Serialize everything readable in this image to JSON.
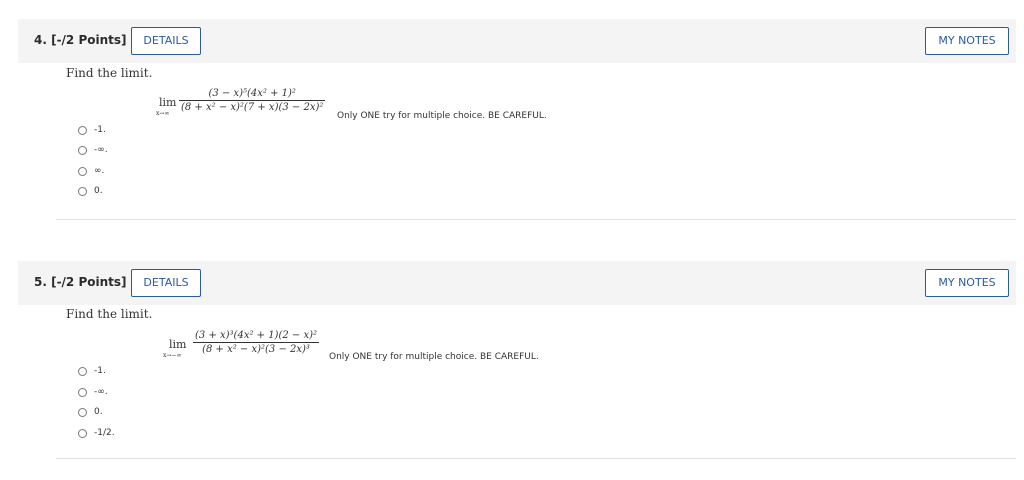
{
  "questions": [
    {
      "number_label": "4. [-/2 Points]",
      "details_label": "DETAILS",
      "notes_label": "MY NOTES",
      "prompt": "Find the limit.",
      "lim_label": "lim",
      "lim_sub": "x→∞",
      "numerator": "(3 − x)⁵(4x² + 1)²",
      "denominator": "(8 + x² − x)²(7 + x)(3 − 2x)²",
      "note": "Only ONE try for multiple choice. BE CAREFUL.",
      "choices": [
        "-1.",
        "-∞.",
        "∞.",
        "0."
      ]
    },
    {
      "number_label": "5. [-/2 Points]",
      "details_label": "DETAILS",
      "notes_label": "MY NOTES",
      "prompt": "Find the limit.",
      "lim_label": "lim",
      "lim_sub": "x→−∞",
      "numerator": "(3 + x)³(4x² + 1)(2 − x)²",
      "denominator": "(8 + x² − x)²(3 − 2x)³",
      "note": "Only ONE try for multiple choice. BE CAREFUL.",
      "choices": [
        "-1.",
        "-∞.",
        "0.",
        "-1/2."
      ]
    }
  ]
}
